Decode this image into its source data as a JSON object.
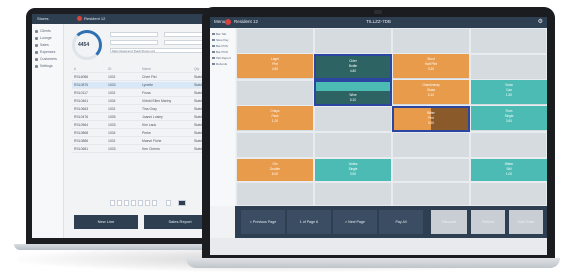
{
  "back": {
    "app": "Stores",
    "store": "Resident 12",
    "sidebar": [
      "Clients",
      "Lounge",
      "Sales",
      "Expenses",
      "Customers",
      "Settings"
    ],
    "ring_value": "4454",
    "fields": [
      "",
      "",
      "",
      "",
      "Mars Road and Toadi Shops Ltd"
    ],
    "table": {
      "header": [
        "#",
        "ID",
        "Name",
        "Qty"
      ],
      "rows": [
        [
          "RSL6086",
          "1001",
          "Cheri Flei",
          "Stable"
        ],
        [
          "RSL0875",
          "1003",
          "Lynette",
          "Stable"
        ],
        [
          "RSL0117",
          "1001",
          "Fiona",
          "Stable"
        ],
        [
          "RSL0461",
          "1004",
          "Virfold Ellen Mariny",
          "Stable"
        ],
        [
          "RSL0663",
          "1001",
          "Tina Gray",
          "Stable"
        ],
        [
          "RSL0476",
          "1005",
          "Joanni Lusley",
          "Stable"
        ],
        [
          "RSL0564",
          "1003",
          "Kim Lauk",
          "Stable"
        ],
        [
          "RSL0868",
          "1004",
          "Perke",
          "Stable"
        ],
        [
          "RSL0886",
          "1001",
          "Maevri Fiche",
          "Stable"
        ],
        [
          "RSL0681",
          "1003",
          "Ken Cheres",
          "Stable"
        ]
      ]
    },
    "buttons": [
      "New Line",
      "Sales Report"
    ]
  },
  "front": {
    "app": "Menu",
    "store": "Resident 12",
    "title": "TILLZZ-7DB",
    "sidebar": [
      "Bar Tab",
      "Slow Pay",
      "Bar POS",
      "Bar POS",
      "Tab Report",
      "Refunds"
    ],
    "cards": [
      {
        "title": "Lager",
        "sub": "Pint",
        "price": "4.50"
      },
      {
        "title": "Cider",
        "sub": "Bottle",
        "price": "4.80"
      },
      {
        "title": "Stout",
        "sub": "Half Pint",
        "price": "3.20"
      },
      {
        "title": "Wine",
        "sub": "Red Glass",
        "price": "5.20"
      },
      {
        "title": "Chardonnay",
        "sub": "Glass",
        "price": "6.10"
      },
      {
        "title": "Soda",
        "sub": "Can",
        "price": "1.50"
      },
      {
        "title": "Crisps",
        "sub": "Pack",
        "price": "1.20"
      },
      {
        "title": "Bitter",
        "sub": "Pint",
        "price": "3.90"
      },
      {
        "title": "Rum",
        "sub": "Single",
        "price": "3.60"
      },
      {
        "title": "Gin",
        "sub": "Double",
        "price": "6.00"
      },
      {
        "title": "Vodka",
        "sub": "Single",
        "price": "3.50"
      },
      {
        "title": "Water",
        "sub": "Still",
        "price": "1.00"
      }
    ],
    "toolbar": [
      "< Previous Page",
      "1 of Page 6",
      "> Next Page",
      "Pay All",
      "Discount",
      "Refund",
      "Void Order"
    ]
  }
}
